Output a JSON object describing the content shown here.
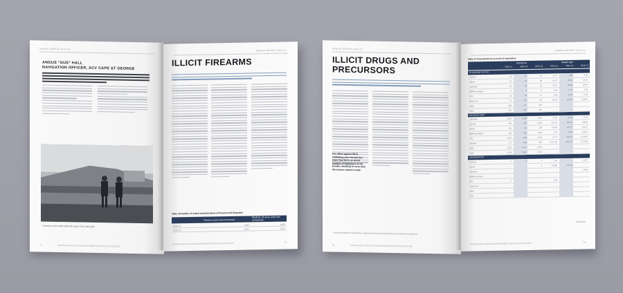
{
  "left_book": {
    "left_page": {
      "header": "Annual Report 2012–13",
      "name_line": "ANGUS \"GUS\" HALL",
      "role_line": "NAVIGATION OFFICER, ACV CAPE ST GEORGE",
      "caption": "Customs vessel Hobart (left) with Angus 'Gus' Hall (right)",
      "page_number": "72",
      "footer": "AUSTRALIAN CUSTOMS AND BORDER PROTECTION SERVICE"
    },
    "right_page": {
      "header": "Annual Report 2012–13",
      "title": "ILLICIT FIREARMS",
      "table_title": "Table 16   Number of seized and detections of firearms and disposals",
      "table_col1": "Firearms, parts and accessories",
      "table_col2": "Replicas, air guns, parts and accessories",
      "table_rows": [
        [
          "2011–12",
          "1,412",
          "4,094"
        ],
        [
          "2012–13",
          "1,077",
          "4,011"
        ]
      ],
      "page_number": "73",
      "footer": "AUSTRALIAN CUSTOMS AND BORDER PROTECTION SERVICE"
    }
  },
  "right_book": {
    "left_page": {
      "header": "Annual Report 2012–13",
      "title_line1": "ILLICIT DRUGS AND",
      "title_line2": "PRECURSORS",
      "pull_quote": "Our effort against illicit trafficking over the last few years has led to a record number of detections at the border, resulting in more than the tonnes seized in total.",
      "footnote": "* Including synthetic cannabinoids, amphetamine-type stimulants and new psychoactive substances.",
      "page_number": "82",
      "footer": "AUSTRALIAN CUSTOMS AND BORDER PROTECTION SERVICE"
    },
    "right_page": {
      "header": "Annual Report 2012–13",
      "table_title": "Table 17   Drug detections by mode of importation",
      "group_detections": "Detections",
      "group_weight": "Weight (kg)*",
      "years": [
        "2010–11",
        "2011–12",
        "2012–13",
        "2010–11",
        "2011–12",
        "2012–13"
      ],
      "section_air": "Air passenger and crew",
      "section_cargo": "Sea and air cargo*",
      "section_mail": "International mail",
      "rows_air": [
        [
          "Cocaine",
          "42",
          "74",
          "50",
          "11.74",
          "1.88",
          "6.29"
        ],
        [
          "Heroin",
          "20",
          "25",
          "28",
          "60.79",
          "38.91",
          "46.39"
        ],
        [
          "Cannabis",
          "14",
          "18",
          "22",
          "37.51",
          "58.48",
          "86.49"
        ],
        [
          "MDMA (ecstasy)",
          "5",
          "8",
          "8",
          "0.09",
          "0.07",
          "0.08"
        ],
        [
          "ATS",
          "61",
          "62",
          "73",
          "8.69",
          "24.49",
          "72.28"
        ],
        [
          "Precursors",
          "73",
          "146",
          "173",
          "94.99",
          "250.32",
          "219.83"
        ],
        [
          "Other",
          "228",
          "417",
          "346",
          "–",
          "–",
          "–"
        ],
        [
          "Total",
          "367",
          "617",
          "540",
          "–",
          "–",
          "–"
        ]
      ],
      "rows_cargo": [
        [
          "Cannabis",
          "2,262",
          "2,628",
          "3,357",
          "37.81",
          "51.28",
          "74.23"
        ],
        [
          "Cocaine",
          "463",
          "432",
          "1,419",
          "207.21",
          "450.91",
          "308.80"
        ],
        [
          "Heroin",
          "106",
          "181",
          "190",
          "279.58",
          "237.77",
          "424.53"
        ],
        [
          "MDMA (ecstasy)",
          "108",
          "381",
          "4,136",
          "8.78",
          "11.98",
          "148.10"
        ],
        [
          "ATS",
          "1,062",
          "1,338",
          "1,523",
          "97.77",
          "329.16",
          "2,278.86"
        ],
        [
          "Steroids",
          "273",
          "808",
          "887",
          "3,377.28",
          "1,817.20",
          "1,712.88"
        ],
        [
          "Other",
          "3,336",
          "6,314",
          "6,678",
          "–",
          "–",
          "–"
        ],
        [
          "Total",
          "4,784",
          "5,920",
          "6,326",
          "–",
          "–",
          "–"
        ]
      ],
      "rows_mail": [
        [
          "Cocaine",
          "3",
          "5",
          "4",
          "0.04",
          "–",
          "30.00"
        ],
        [
          "Heroin",
          "–",
          "–",
          "3",
          "435.88",
          "340.40",
          "–"
        ],
        [
          "Cannabis",
          "–",
          "–",
          "–",
          "–",
          "–",
          "15.84"
        ],
        [
          "MDMA (ecstasy)",
          "–",
          "–",
          "–",
          "–",
          "–",
          "–"
        ],
        [
          "ATS",
          "2",
          "–",
          "–",
          "0.85",
          "–",
          "–"
        ],
        [
          "Precursors",
          "–",
          "–",
          "–",
          "–",
          "–",
          "–"
        ],
        [
          "Other",
          "–",
          "–",
          "–",
          "–",
          "–",
          "–"
        ],
        [
          "Total",
          "–",
          "–",
          "–",
          "–",
          "–",
          "–"
        ]
      ],
      "continued": "(continued)",
      "page_number": "83",
      "footer": "AUSTRALIAN CUSTOMS AND BORDER PROTECTION SERVICE"
    }
  }
}
